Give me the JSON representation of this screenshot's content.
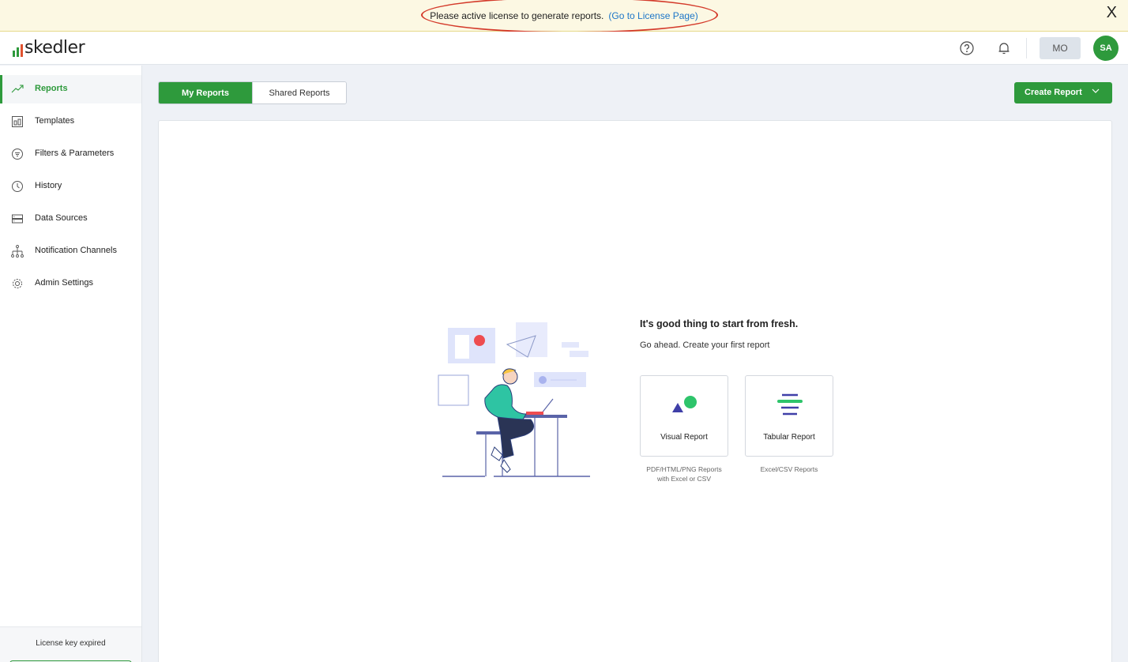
{
  "banner": {
    "message": "Please active license to generate reports.",
    "link": "(Go to License Page)",
    "close": "X"
  },
  "header": {
    "logo": "skedler",
    "icons": [
      "help-icon",
      "bell-icon"
    ],
    "org_button": "MO",
    "avatar": "SA",
    "colors": {
      "accent": "#2e9a3c"
    }
  },
  "sidebar": {
    "items": [
      {
        "label": "Reports",
        "icon": "trend-up-icon",
        "active": true
      },
      {
        "label": "Templates",
        "icon": "template-icon"
      },
      {
        "label": "Filters & Parameters",
        "icon": "filter-icon"
      },
      {
        "label": "History",
        "icon": "clock-icon"
      },
      {
        "label": "Data Sources",
        "icon": "database-icon"
      },
      {
        "label": "Notification Channels",
        "icon": "hierarchy-icon"
      },
      {
        "label": "Admin Settings",
        "icon": "gear-icon"
      }
    ],
    "license_text": "License key expired"
  },
  "tabs": [
    {
      "label": "My Reports",
      "active": true
    },
    {
      "label": "Shared Reports",
      "active": false
    }
  ],
  "create_button": "Create Report",
  "empty": {
    "title": "It's good thing to start from fresh.",
    "subtitle": "Go ahead. Create your first report",
    "cards": [
      {
        "label": "Visual Report",
        "note": [
          "PDF/HTML/PNG Reports",
          "with Excel or CSV"
        ]
      },
      {
        "label": "Tabular Report",
        "note": [
          "Excel/CSV Reports"
        ]
      }
    ]
  }
}
